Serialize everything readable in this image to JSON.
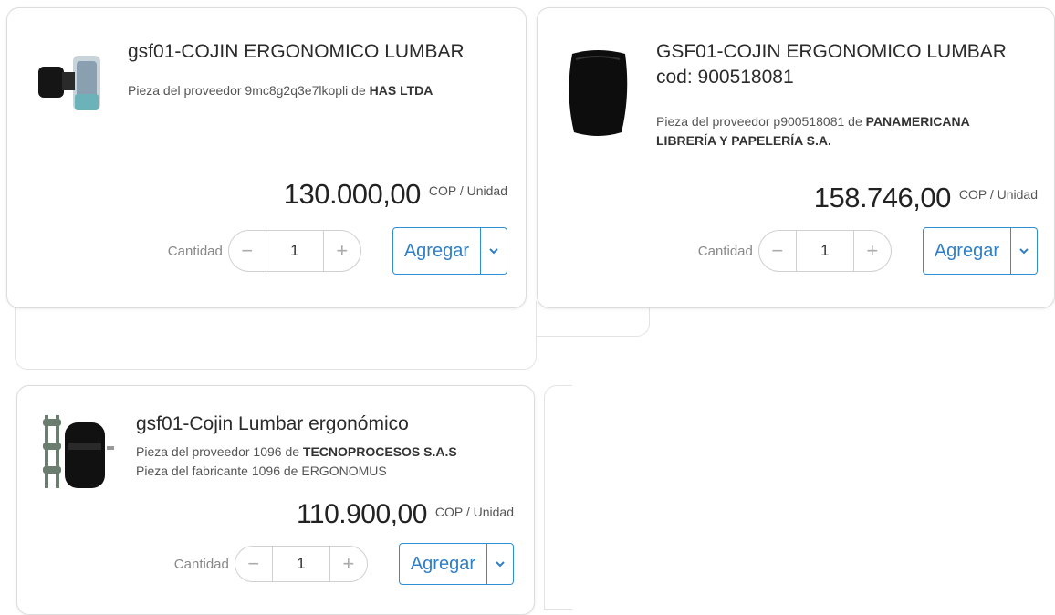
{
  "products": [
    {
      "title": "gsf01-COJIN ERGONOMICO LUMBAR",
      "supplier_prefix": "Pieza del proveedor 9mc8g2q3e7lkopli de",
      "supplier_name": "HAS LTDA",
      "price": "130.000,00",
      "unit": "COP / Unidad",
      "quantity_label": "Cantidad",
      "quantity": "1",
      "add_label": "Agregar"
    },
    {
      "title": "GSF01-COJIN ERGONOMICO LUMBAR cod: 900518081",
      "supplier_prefix": "Pieza del proveedor p900518081 de",
      "supplier_name": "PANAMERICANA LIBRERÍA Y PAPELERÍA S.A.",
      "price": "158.746,00",
      "unit": "COP / Unidad",
      "quantity_label": "Cantidad",
      "quantity": "1",
      "add_label": "Agregar"
    },
    {
      "title": "gsf01-Cojin Lumbar ergonómico",
      "supplier_prefix": "Pieza del proveedor 1096 de",
      "supplier_name": "TECNOPROCESOS S.A.S",
      "manufacturer_prefix": "Pieza del fabricante 1096 de",
      "manufacturer_name": "ERGONOMUS",
      "price": "110.900,00",
      "unit": "COP / Unidad",
      "quantity_label": "Cantidad",
      "quantity": "1",
      "add_label": "Agregar"
    }
  ],
  "icons": {
    "minus": "−",
    "plus": "+",
    "caret": "chevron-down-icon"
  },
  "colors": {
    "accent": "#2f8fd6",
    "border": "#dcdcdc"
  }
}
